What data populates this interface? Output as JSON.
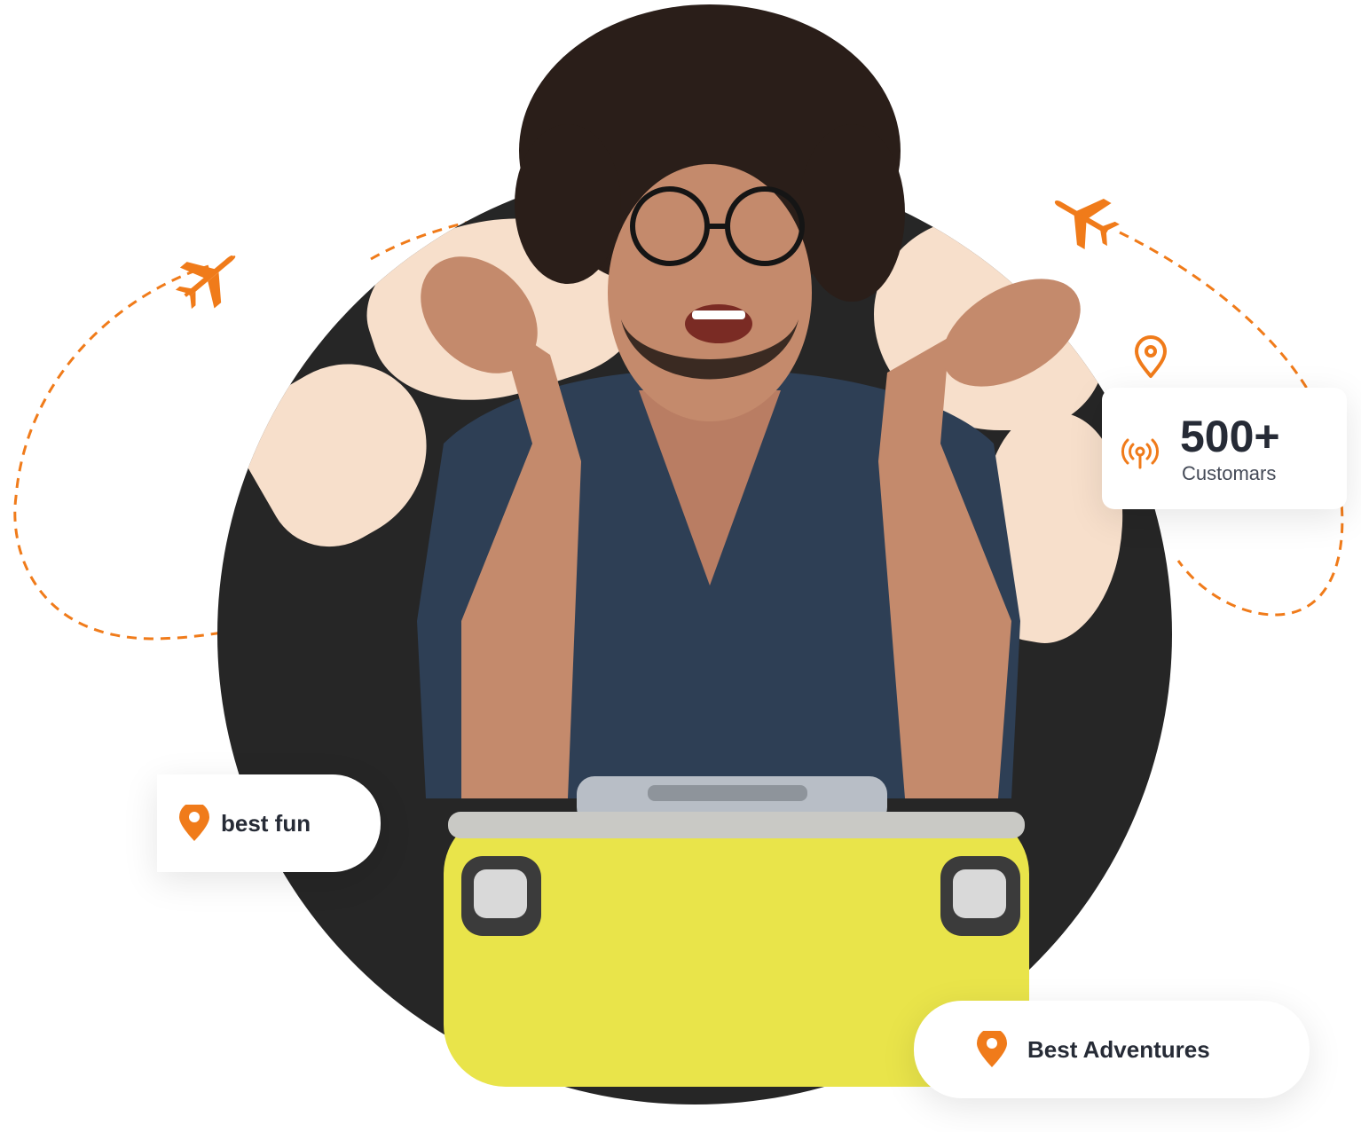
{
  "colors": {
    "accent": "#f07b1a",
    "globe": "#262626",
    "land": "#f7dfcb",
    "text_dark": "#262b36",
    "shirt": "#2e3f55",
    "suitcase": "#e9e44a"
  },
  "stats_card": {
    "value": "500+",
    "label": "Customars",
    "icon": "broadcast-signal-icon"
  },
  "badges": {
    "best_fun": {
      "label": "best fun",
      "icon": "location-pin-icon"
    },
    "best_adventures": {
      "label": "Best Adventures",
      "icon": "location-pin-icon"
    }
  },
  "decorations": {
    "airplane_icons": [
      "airplane-icon",
      "airplane-icon"
    ],
    "floating_pin": "location-pin-icon"
  }
}
